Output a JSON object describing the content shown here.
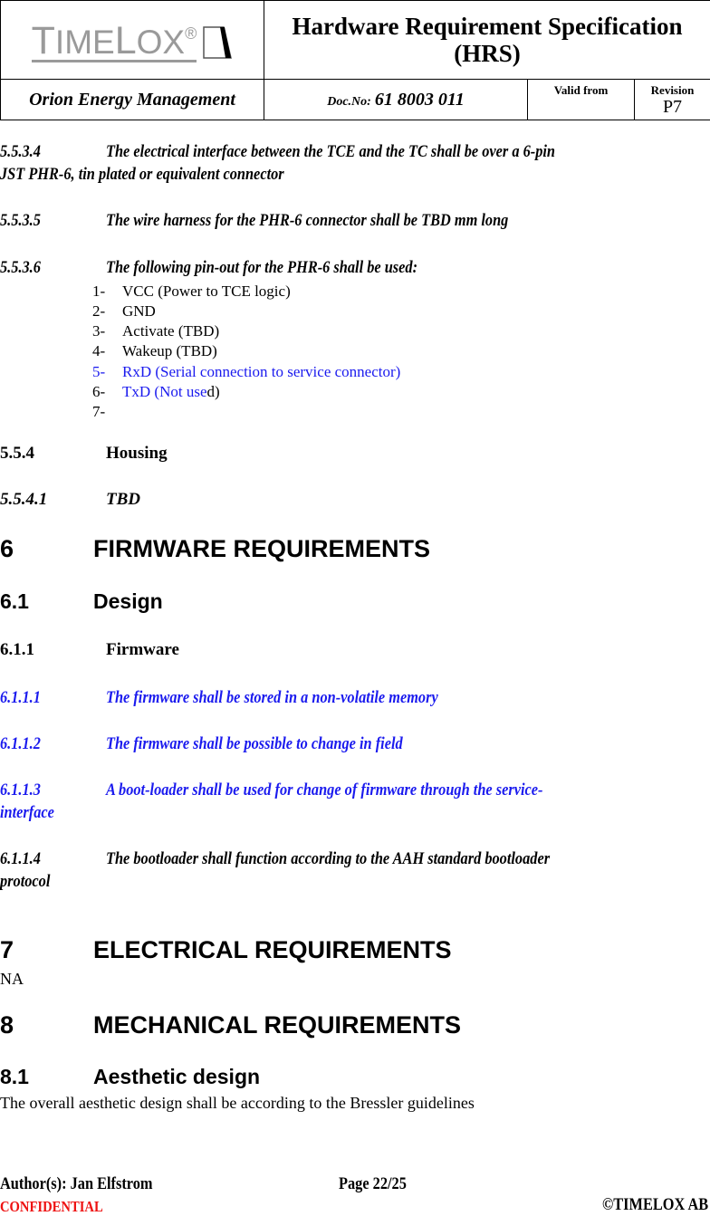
{
  "header": {
    "logo_text_first": "T",
    "logo_text_rest1": "IME",
    "logo_text_big2": "L",
    "logo_text_rest2": "OX",
    "logo_registered": "®",
    "title_line1": "Hardware Requirement Specification",
    "title_line2": "(HRS)",
    "company": "Orion Energy Management",
    "doc_no_label": "Doc.No:",
    "doc_no_value": "61 8003 011",
    "valid_from_label": "Valid from",
    "valid_from_value": "",
    "revision_label": "Revision",
    "revision_value": "P7"
  },
  "sections": {
    "r5534": {
      "num": "5.5.3.4",
      "line1": "The electrical interface between the TCE and the TC shall be over a 6-pin",
      "line2": "JST PHR-6, tin plated or equivalent connector"
    },
    "r5535": {
      "num": "5.5.3.5",
      "text": "The wire harness for the PHR-6 connector shall be TBD mm long"
    },
    "r5536": {
      "num": "5.5.3.6",
      "text": "The following pin-out for the PHR-6 shall be used:"
    },
    "pins": [
      {
        "num": "1-",
        "text": "VCC (Power to TCE logic)",
        "color": "black"
      },
      {
        "num": "2-",
        "text": "GND",
        "color": "black"
      },
      {
        "num": "3-",
        "text": "Activate (TBD)",
        "color": "black"
      },
      {
        "num": "4-",
        "text": "Wakeup (TBD)",
        "color": "black"
      },
      {
        "num": "5-",
        "text": "RxD (Serial connection to service connector)",
        "color": "blue"
      },
      {
        "num": "6-",
        "text_blue": "TxD (Not use",
        "text_black": "d)",
        "color": "mixed"
      },
      {
        "num": "7-",
        "text": ""
      }
    ],
    "s554": {
      "num": "5.5.4",
      "title": "Housing"
    },
    "s5541": {
      "num": "5.5.4.1",
      "title": "TBD"
    },
    "s6": {
      "num": "6",
      "title": "FIRMWARE REQUIREMENTS"
    },
    "s61": {
      "num": "6.1",
      "title": "Design"
    },
    "s611": {
      "num": "6.1.1",
      "title": "Firmware"
    },
    "r6111": {
      "num": "6.1.1.1",
      "text": "The firmware shall be stored in a non-volatile memory"
    },
    "r6112": {
      "num": "6.1.1.2",
      "text": "The firmware shall be possible to change in field"
    },
    "r6113": {
      "num": "6.1.1.3",
      "line1": "A boot-loader shall be used for change of firmware through the service-",
      "line2": "interface"
    },
    "r6114": {
      "num": "6.1.1.4",
      "line1": "The bootloader shall function according to the AAH standard bootloader",
      "line2": "protocol"
    },
    "s7": {
      "num": "7",
      "title": "ELECTRICAL REQUIREMENTS",
      "body": "NA"
    },
    "s8": {
      "num": "8",
      "title": "MECHANICAL REQUIREMENTS"
    },
    "s81": {
      "num": "8.1",
      "title": "Aesthetic design",
      "body": "The overall aesthetic design shall be according to the Bressler guidelines"
    }
  },
  "footer": {
    "author": "Author(s): Jan Elfstrom",
    "page": "Page 22/25",
    "confidential": "CONFIDENTIAL",
    "copyright": "©TIMELOX AB"
  },
  "colors": {
    "requirement_blue": "#1a1aee",
    "confidential_red": "#ee1111",
    "logo_gray": "#9a9a9a"
  }
}
